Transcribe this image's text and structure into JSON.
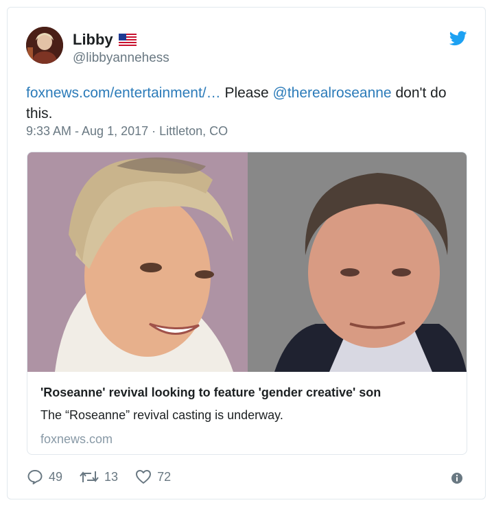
{
  "tweet": {
    "author_name": "Libby",
    "author_handle": "@libbyannehess",
    "link_text": "foxnews.com/entertainment/…",
    "text_mid": " Please ",
    "mention": "@therealroseanne",
    "text_end": " don't do this.",
    "timestamp": "9:33 AM - Aug 1, 2017 · Littleton, CO",
    "icons": {
      "verified_flag": "us-flag-icon",
      "platform": "twitter-bird-icon"
    }
  },
  "card": {
    "title": "'Roseanne' revival looking to feature 'gender creative' son",
    "description": "The “Roseanne” revival casting is underway.",
    "domain": "foxnews.com"
  },
  "actions": {
    "replies": "49",
    "retweets": "13",
    "likes": "72"
  },
  "colors": {
    "link": "#2b7bb9",
    "meta": "#697882",
    "twitter_blue": "#1da1f2",
    "border": "#e1e8ed"
  }
}
